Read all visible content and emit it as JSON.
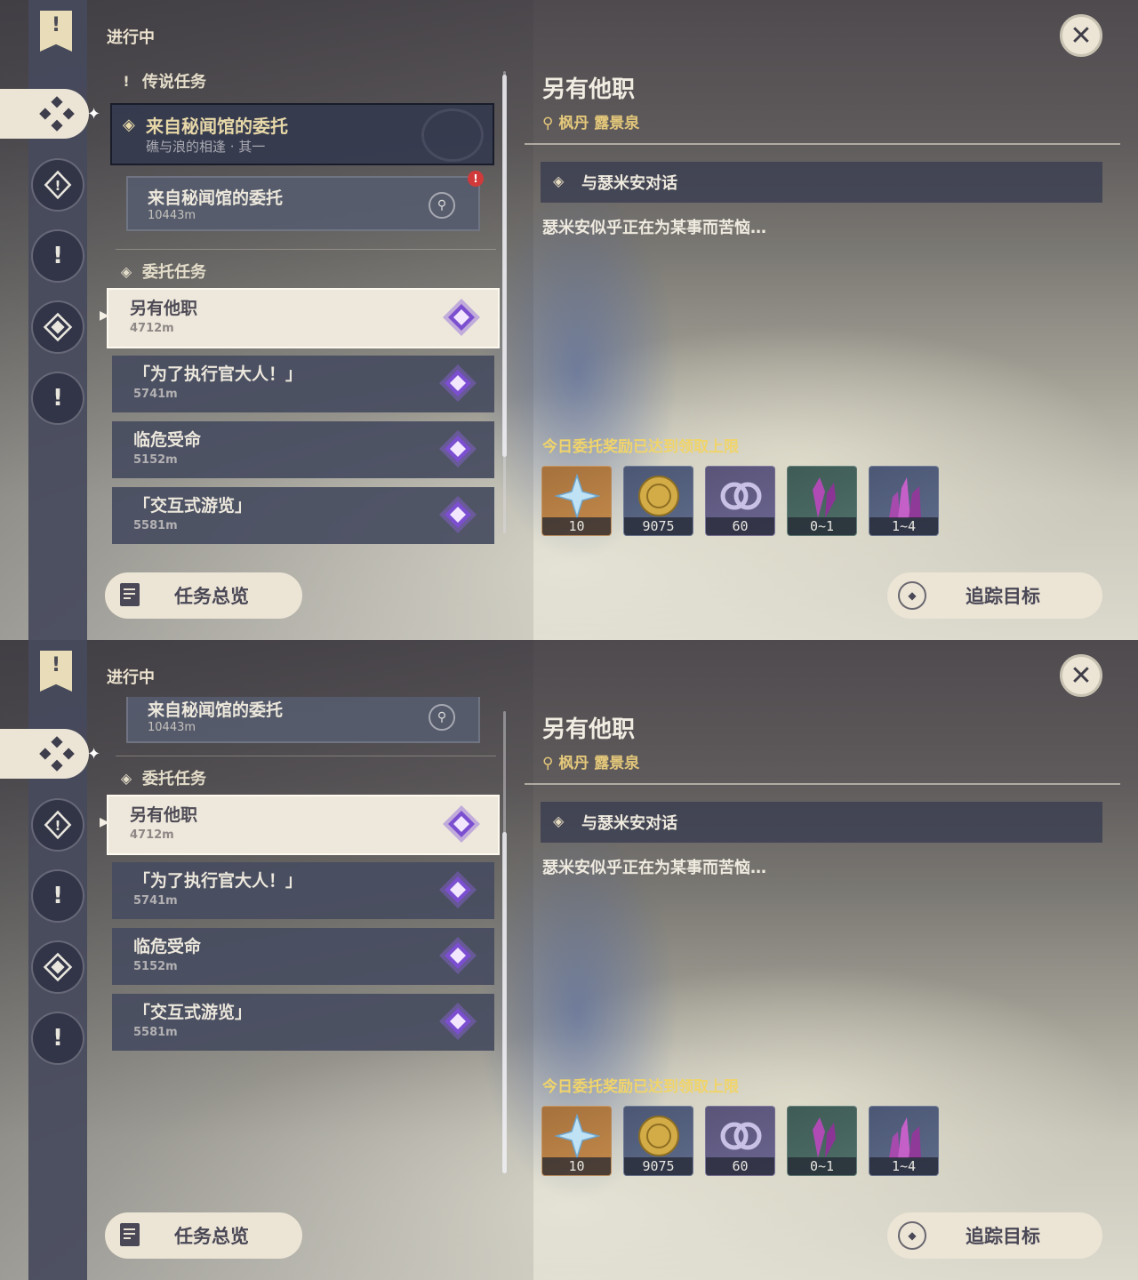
{
  "header": {
    "ongoing": "进行中",
    "close_icon": "close-icon"
  },
  "sidebar": {
    "tabs": [
      {
        "name": "banner-icon",
        "glyph": "!"
      },
      {
        "name": "commission-tab-icon"
      },
      {
        "name": "world-quest-icon"
      },
      {
        "name": "archon-quest-icon",
        "glyph": "!"
      },
      {
        "name": "story-quest-icon"
      },
      {
        "name": "exclamation-icon",
        "glyph": "!"
      }
    ]
  },
  "legend": {
    "section_title": "传说任务",
    "header_title": "来自秘闻馆的委托",
    "header_subtitle": "礁与浪的相逢 · 其一",
    "item_title": "来自秘闻馆的委托",
    "item_distance": "10443m",
    "alert": "!"
  },
  "commissions": {
    "section_title": "委托任务",
    "items": [
      {
        "title": "另有他职",
        "distance": "4712m"
      },
      {
        "title": "「为了执行官大人！」",
        "distance": "5741m"
      },
      {
        "title": "临危受命",
        "distance": "5152m"
      },
      {
        "title": "「交互式游览」",
        "distance": "5581m"
      }
    ]
  },
  "detail": {
    "title": "另有他职",
    "location": "枫丹 露景泉",
    "objective": "与瑟米安对话",
    "description": "瑟米安似乎正在为某事而苦恼…",
    "reward_note": "今日委托奖励已达到领取上限",
    "rewards": [
      {
        "name": "primogem-icon",
        "qty": "10",
        "bg": "orange"
      },
      {
        "name": "mora-icon",
        "qty": "9075",
        "bg": "blue"
      },
      {
        "name": "friendship-exp-icon",
        "qty": "60",
        "bg": "purple"
      },
      {
        "name": "amethyst-crystal-icon",
        "qty": "0~1",
        "bg": "green"
      },
      {
        "name": "amethyst-cluster-icon",
        "qty": "1~4",
        "bg": "blue"
      }
    ]
  },
  "buttons": {
    "overview": "任务总览",
    "track": "追踪目标"
  },
  "colors": {
    "accent_gold": "#e3c77a",
    "reward_note": "#f0d46a",
    "button_bg": "#ece5d6",
    "commission_icon": "#8a62d8"
  }
}
